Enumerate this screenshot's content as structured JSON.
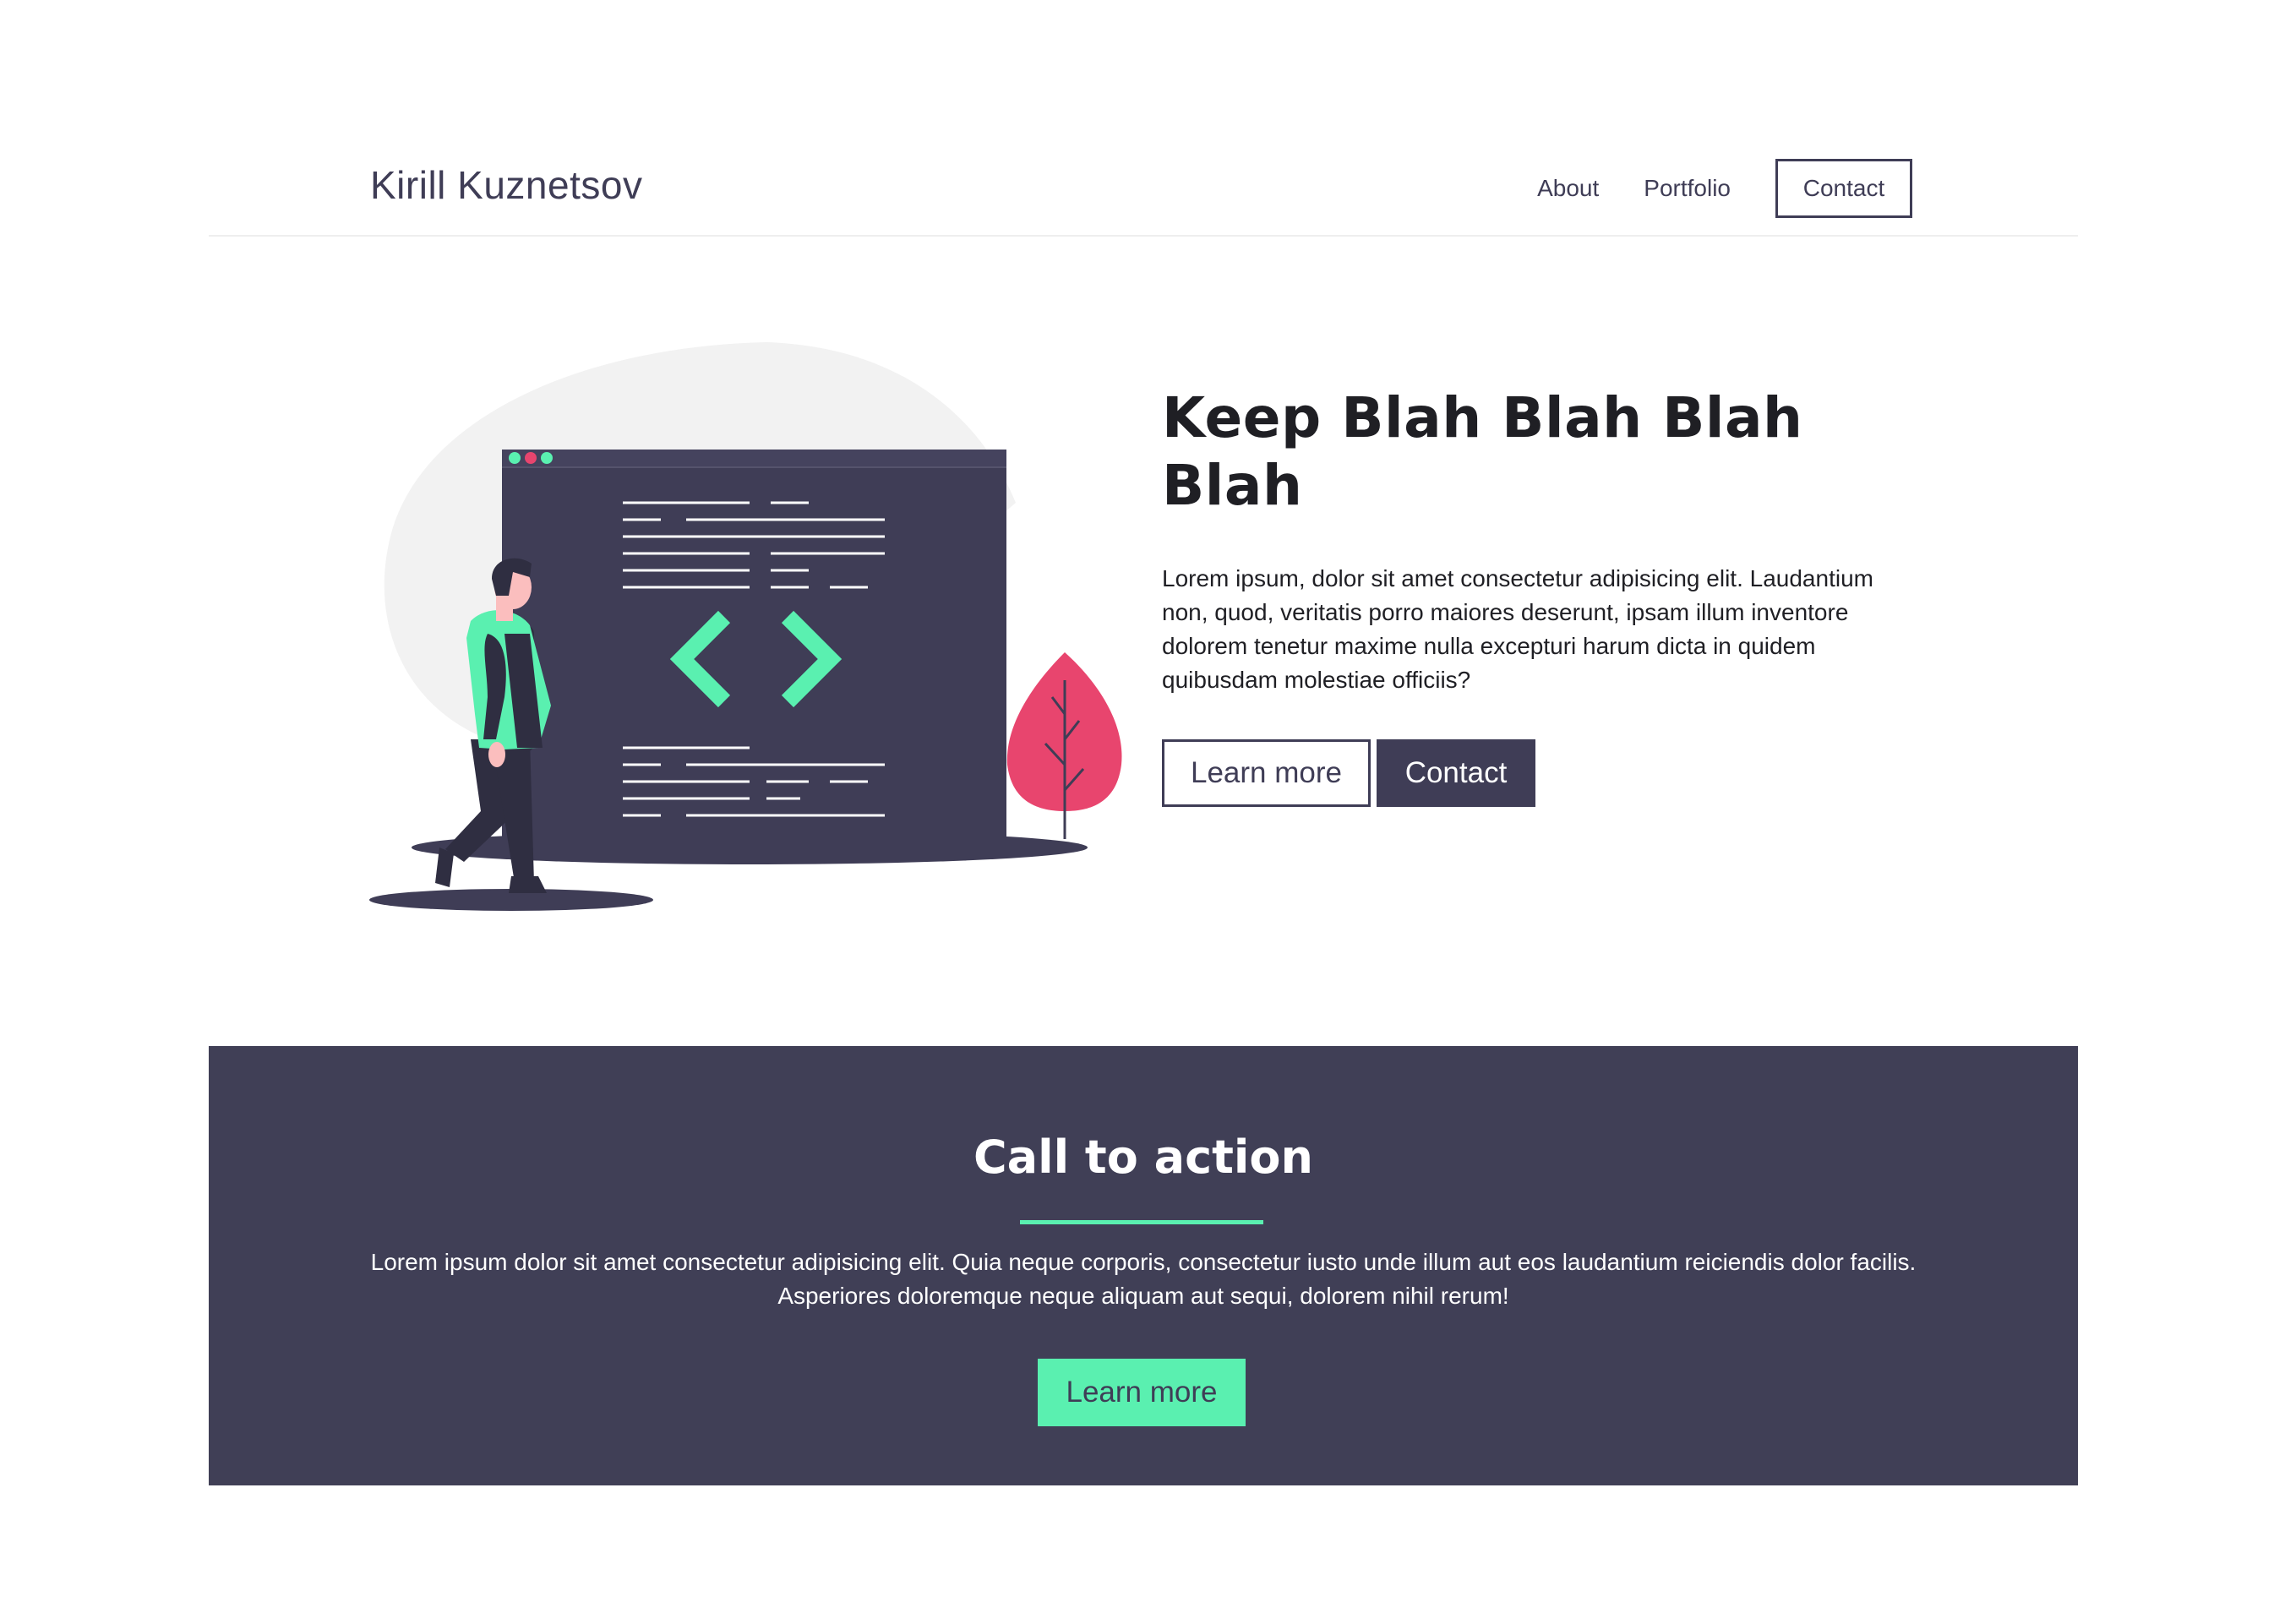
{
  "header": {
    "brand": "Kirill Kuznetsov",
    "nav": {
      "about": "About",
      "portfolio": "Portfolio",
      "contact": "Contact"
    }
  },
  "hero": {
    "illustration_icon": "developer-code-window-illustration",
    "title": "Keep Blah Blah Blah Blah",
    "description": "Lorem ipsum, dolor sit amet consectetur adipisicing elit. Laudantium non, quod, veritatis porro maiores deserunt, ipsam illum inventore dolorem tenetur maxime nulla excepturi harum dicta in quidem quibusdam molestiae officiis?",
    "learn_more": "Learn more",
    "contact": "Contact"
  },
  "cta": {
    "title": "Call to action",
    "text": "Lorem ipsum dolor sit amet consectetur adipisicing elit. Quia neque corporis, consectetur iusto unde illum aut eos laudantium reiciendis dolor facilis. Asperiores doloremque neque aliquam aut sequi, dolorem nihil rerum!",
    "button": "Learn more"
  },
  "colors": {
    "primary_dark": "#3f3d56",
    "accent_green": "#5af0b0",
    "accent_pink": "#e8456e",
    "blob_gray": "#f2f2f2"
  }
}
